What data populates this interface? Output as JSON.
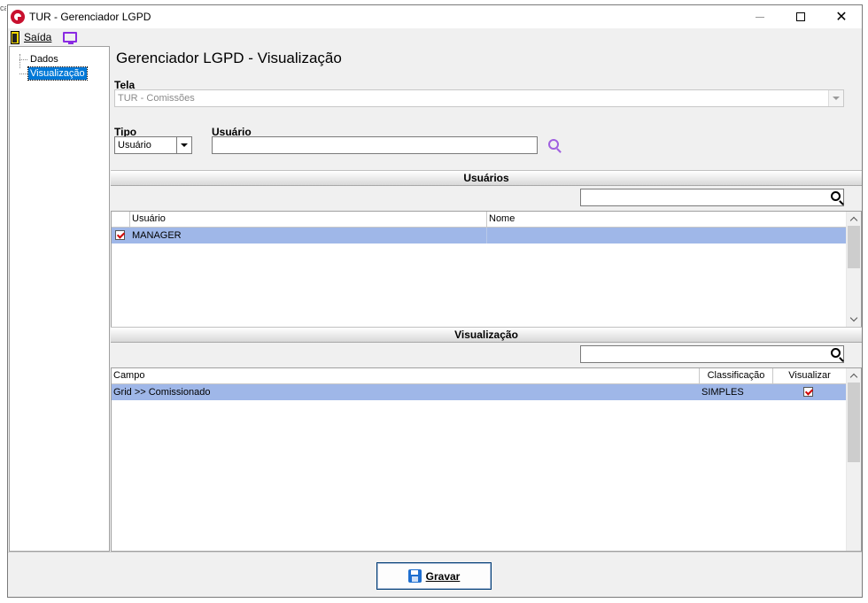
{
  "window": {
    "title": "TUR - Gerenciador LGPD",
    "controls": [
      "minimize",
      "maximize",
      "close"
    ]
  },
  "menubar": {
    "exit_label": "Saída",
    "exit_icon": "door-icon",
    "display_icon": "monitor-icon"
  },
  "tree": {
    "items": [
      {
        "label": "Dados",
        "selected": false
      },
      {
        "label": "Visualização",
        "selected": true
      }
    ]
  },
  "main": {
    "page_title": "Gerenciador LGPD - Visualização",
    "tela": {
      "label": "Tela",
      "value": "TUR - Comissões"
    },
    "tipo": {
      "label": "Tipo",
      "value": "Usuário"
    },
    "usuario": {
      "label": "Usuário",
      "value": ""
    }
  },
  "users_section": {
    "title": "Usuários",
    "filter_value": "",
    "columns": [
      "Usuário",
      "Nome"
    ],
    "rows": [
      {
        "checked": true,
        "usuario": "MANAGER",
        "nome": ""
      }
    ]
  },
  "view_section": {
    "title": "Visualização",
    "filter_value": "",
    "columns": [
      "Campo",
      "Classificação",
      "Visualizar"
    ],
    "rows": [
      {
        "campo": "Grid >> Comissionado",
        "classificacao": "SIMPLES",
        "visualizar": true
      }
    ]
  },
  "footer": {
    "save_label": "Gravar",
    "save_icon": "floppy-icon"
  },
  "colors": {
    "selection_row": "#9fb7e8",
    "tree_selection": "#0078d7",
    "search_accent": "#a060e0",
    "check_mark": "#d00000"
  }
}
